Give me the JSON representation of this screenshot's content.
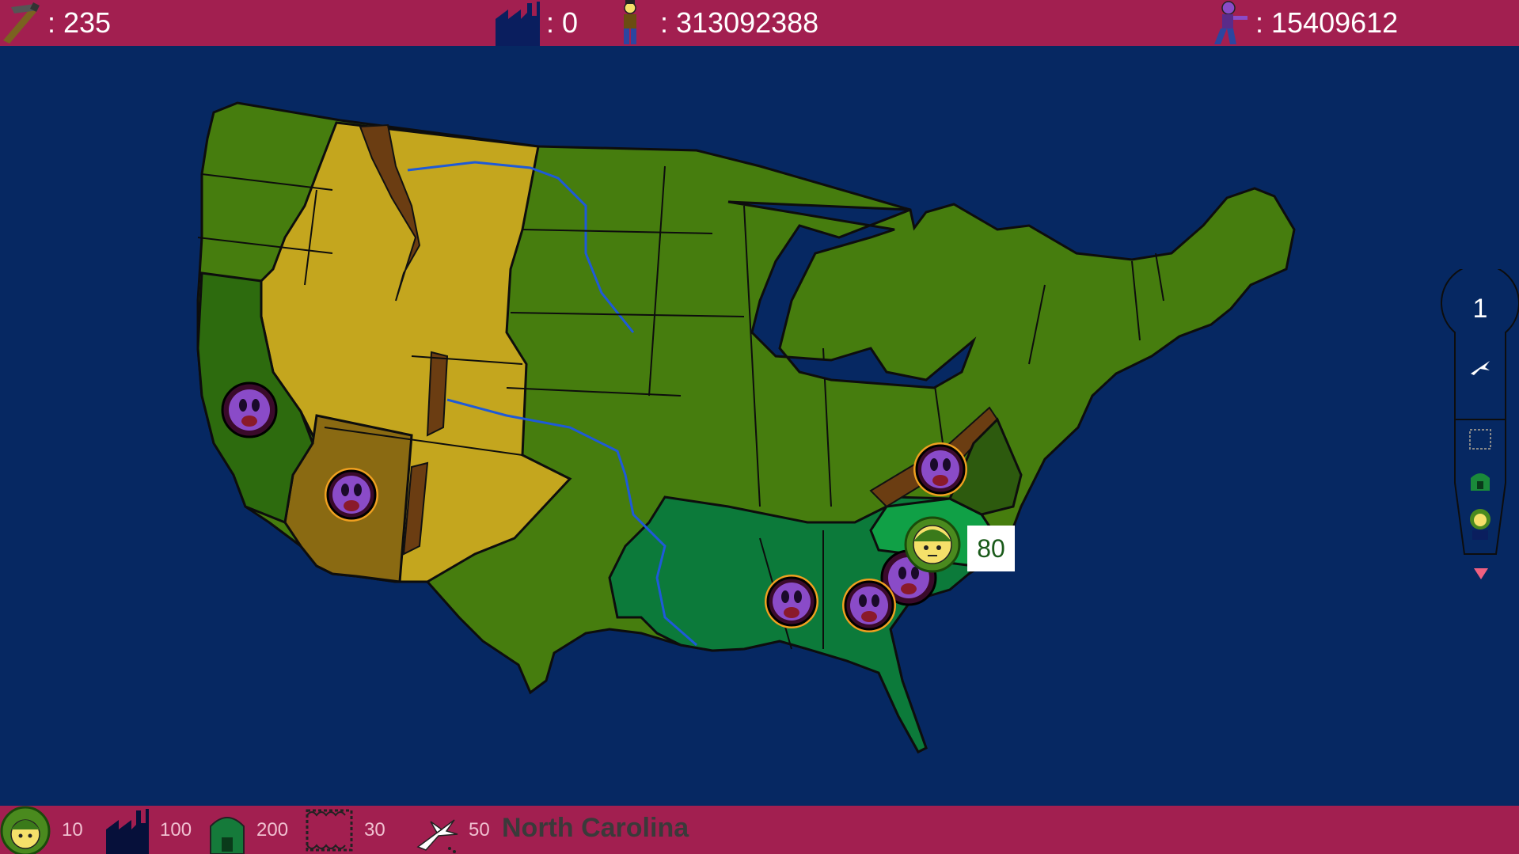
{
  "top_bar": {
    "money": ": 235",
    "factories": ": 0",
    "population": ": 313092388",
    "enemies": ": 15409612"
  },
  "bottom_bar": {
    "costs": [
      {
        "item": "soldier",
        "icon": "soldier-icon",
        "value": "10"
      },
      {
        "item": "factory",
        "icon": "factory-icon",
        "value": "100"
      },
      {
        "item": "bunker",
        "icon": "bunker-icon",
        "value": "200"
      },
      {
        "item": "barbed-wire",
        "icon": "barbed-wire-icon",
        "value": "30"
      },
      {
        "item": "airplane",
        "icon": "airplane-icon",
        "value": "50"
      }
    ],
    "selected_region": "North Carolina"
  },
  "side_panel": {
    "count": "1"
  },
  "map": {
    "troop_count": "80",
    "colors": {
      "ocean": "#062862",
      "plains": "#467d0e",
      "desert": "#c4a61e",
      "player": "#0c7a3a",
      "mountain": "#6b3d12"
    }
  }
}
